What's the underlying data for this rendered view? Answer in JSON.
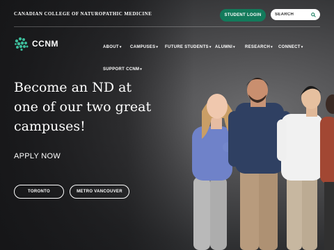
{
  "header": {
    "college_name": "CANADIAN COLLEGE OF NATUROPATHIC MEDICINE",
    "student_login": "STUDENT LOGIN",
    "search_placeholder": "SEARCH"
  },
  "logo": {
    "text": "CCNM"
  },
  "nav": {
    "items": [
      {
        "label": "ABOUT"
      },
      {
        "label": "CAMPUSES"
      },
      {
        "label": "FUTURE STUDENTS"
      },
      {
        "label": "ALUMNI"
      },
      {
        "label": "RESEARCH"
      },
      {
        "label": "CONNECT"
      },
      {
        "label": "SUPPORT CCNM"
      }
    ]
  },
  "hero": {
    "headline": "Become an ND at one of our two great campuses!",
    "apply_now": "APPLY NOW",
    "campus_buttons": [
      {
        "label": "TORONTO"
      },
      {
        "label": "METRO VANCOUVER"
      }
    ]
  },
  "colors": {
    "brand_green": "#137a5b",
    "logo_teal": "#3dbb9a",
    "text": "#ffffff"
  },
  "icons": {
    "search": "magnifier-icon",
    "logo_mark": "ccnm-dots-logo-icon",
    "caret": "chevron-down-icon"
  }
}
